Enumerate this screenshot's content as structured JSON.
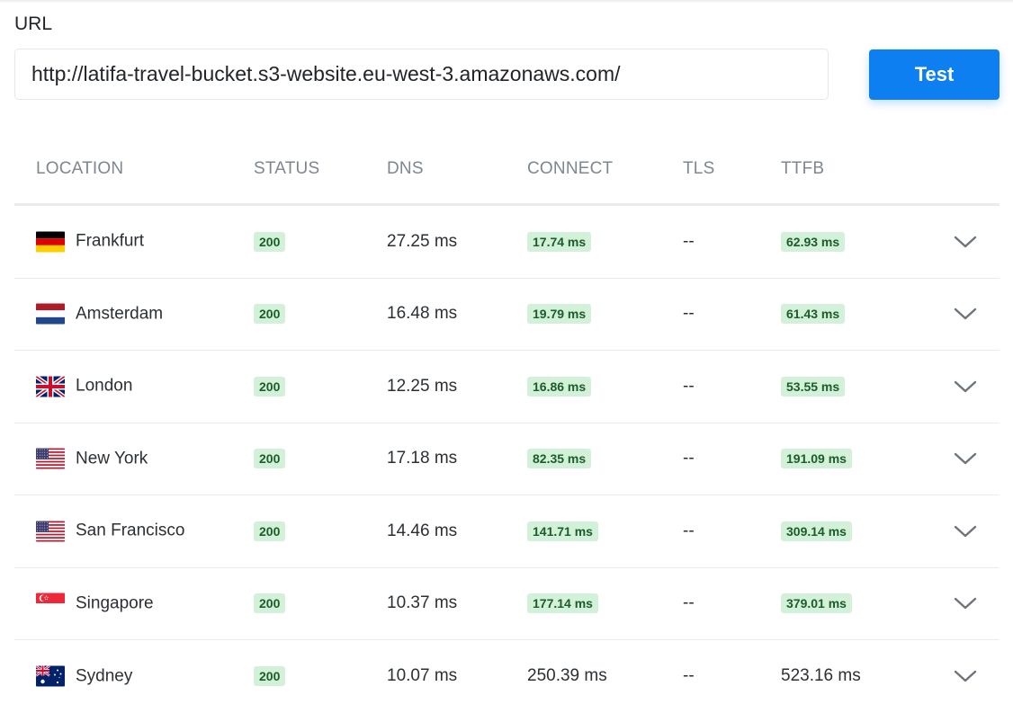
{
  "form": {
    "url_label": "URL",
    "url_value": "http://latifa-travel-bucket.s3-website.eu-west-3.amazonaws.com/",
    "test_label": "Test"
  },
  "table": {
    "headers": {
      "location": "LOCATION",
      "status": "STATUS",
      "dns": "DNS",
      "connect": "CONNECT",
      "tls": "TLS",
      "ttfb": "TTFB"
    },
    "rows": [
      {
        "flag": "flag-germany",
        "location": "Frankfurt",
        "status": "200",
        "dns": "27.25 ms",
        "connect": "17.74 ms",
        "connect_badge": true,
        "tls": "--",
        "ttfb": "62.93 ms",
        "ttfb_badge": true
      },
      {
        "flag": "flag-netherlands",
        "location": "Amsterdam",
        "status": "200",
        "dns": "16.48 ms",
        "connect": "19.79 ms",
        "connect_badge": true,
        "tls": "--",
        "ttfb": "61.43 ms",
        "ttfb_badge": true
      },
      {
        "flag": "flag-united-kingdom",
        "location": "London",
        "status": "200",
        "dns": "12.25 ms",
        "connect": "16.86 ms",
        "connect_badge": true,
        "tls": "--",
        "ttfb": "53.55 ms",
        "ttfb_badge": true
      },
      {
        "flag": "flag-united-states",
        "location": "New York",
        "status": "200",
        "dns": "17.18 ms",
        "connect": "82.35 ms",
        "connect_badge": true,
        "tls": "--",
        "ttfb": "191.09 ms",
        "ttfb_badge": true
      },
      {
        "flag": "flag-united-states",
        "location": "San Francisco",
        "status": "200",
        "dns": "14.46 ms",
        "connect": "141.71 ms",
        "connect_badge": true,
        "tls": "--",
        "ttfb": "309.14 ms",
        "ttfb_badge": true
      },
      {
        "flag": "flag-singapore",
        "location": "Singapore",
        "status": "200",
        "dns": "10.37 ms",
        "connect": "177.14 ms",
        "connect_badge": true,
        "tls": "--",
        "ttfb": "379.01 ms",
        "ttfb_badge": true
      },
      {
        "flag": "flag-australia",
        "location": "Sydney",
        "status": "200",
        "dns": "10.07 ms",
        "connect": "250.39 ms",
        "connect_badge": false,
        "tls": "--",
        "ttfb": "523.16 ms",
        "ttfb_badge": false
      }
    ]
  },
  "colors": {
    "accent": "#0d7ff0",
    "badge_bg": "#d3f0d8",
    "badge_text": "#1a5d2b",
    "header_text": "#7d8791"
  }
}
